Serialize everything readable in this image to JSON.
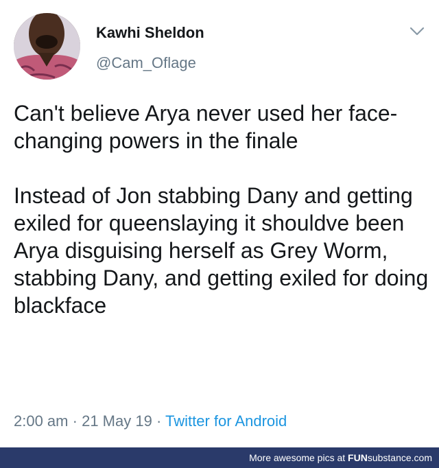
{
  "tweet": {
    "display_name": "Kawhi Sheldon",
    "handle": "@Cam_Oflage",
    "paragraphs": [
      "Can't believe Arya never used her face-changing powers in the finale",
      "Instead of Jon stabbing Dany and getting exiled for queenslaying it shouldve been Arya disguising herself as Grey Worm, stabbing Dany, and getting exiled for doing blackface"
    ],
    "time": "2:00 am",
    "separator": "·",
    "date": "21 May 19",
    "source": "Twitter for Android",
    "icons": {
      "caret": "chevron-down-icon",
      "avatar": "avatar-photo"
    },
    "colors": {
      "text": "#14171a",
      "muted": "#657786",
      "link": "#1b95e0"
    }
  },
  "footer": {
    "prefix": "More awesome pics at ",
    "brand_fun": "FUN",
    "brand_rest": "substance.com",
    "background": "#2a3a6a"
  }
}
